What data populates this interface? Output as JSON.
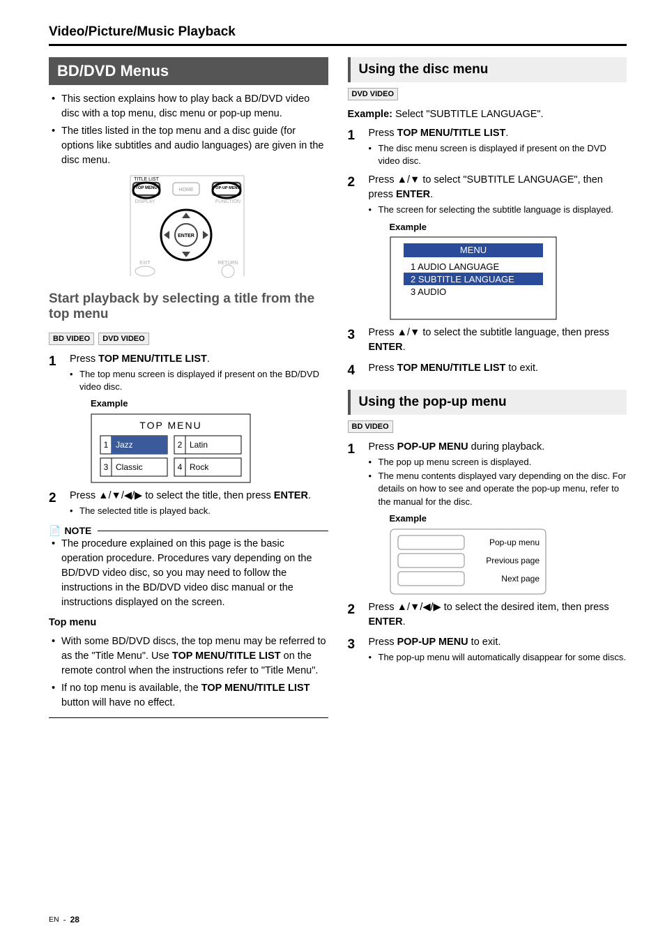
{
  "header": {
    "section_title": "Video/Picture/Music Playback"
  },
  "left": {
    "bar_title": "BD/DVD Menus",
    "intro_bullet1": "This section explains how to play back a BD/DVD video disc with a top menu, disc menu or pop-up menu.",
    "intro_bullet2": "The titles listed in the top menu and a disc guide (for options like subtitles and audio languages) are given in the disc menu.",
    "remote": {
      "title_list": "TITLE LIST",
      "top_menu": "TOP MENU",
      "home": "HOME",
      "popup_menu": "POP-UP MENU",
      "display": "DISPLAY",
      "function": "FUNCTION",
      "enter": "ENTER",
      "exit": "EXIT",
      "return": "RETURN"
    },
    "start_heading": "Start playback by selecting a title from the top menu",
    "tags": {
      "bd": "BD VIDEO",
      "dvd": "DVD VIDEO"
    },
    "step1_a": "Press ",
    "step1_b": "TOP MENU/TITLE LIST",
    "step1_sub": "The top menu screen is displayed if present on the BD/DVD video disc.",
    "example_label": "Example",
    "topmenu": {
      "title": "TOP MENU",
      "cell1": "Jazz",
      "cell2": "Latin",
      "cell3": "Classic",
      "cell4": "Rock"
    },
    "step2_a": "Press ",
    "step2_arrows": "▲/▼/◀/▶",
    "step2_b": " to select the title, then press ",
    "step2_c": "ENTER",
    "step2_sub": "The selected title is played back.",
    "note_label": "NOTE",
    "note_bullet": "The procedure explained on this page is the basic operation procedure. Procedures vary depending on the BD/DVD video disc, so you may need to follow the instructions in the BD/DVD video disc manual or the instructions displayed on the screen.",
    "topmenu_heading": "Top menu",
    "topmenu_b1a": "With some BD/DVD discs, the top menu may be referred to as the \"Title Menu\". Use ",
    "topmenu_b1b": "TOP MENU/TITLE LIST",
    "topmenu_b1c": " on the remote control when the instructions refer to \"Title Menu\".",
    "topmenu_b2a": "If no top menu is available, the ",
    "topmenu_b2b": "TOP MENU/TITLE LIST",
    "topmenu_b2c": " button will have no effect."
  },
  "right": {
    "disc_heading": "Using the disc menu",
    "tag_dvd": "DVD VIDEO",
    "example_prefix": "Example:",
    "example_text": " Select \"SUBTITLE LANGUAGE\".",
    "step1_a": "Press ",
    "step1_b": "TOP MENU/TITLE LIST",
    "step1_sub": "The disc menu screen is displayed if present on the DVD video disc.",
    "step2_a": "Press ",
    "step2_arrows": "▲/▼",
    "step2_b": " to select \"SUBTITLE LANGUAGE\", then press ",
    "step2_c": "ENTER",
    "step2_sub": "The screen for selecting the subtitle language is displayed.",
    "example_label": "Example",
    "menu": {
      "title": "MENU",
      "row1": "1  AUDIO LANGUAGE",
      "row2": "2  SUBTITLE LANGUAGE",
      "row3": "3  AUDIO"
    },
    "step3_a": "Press ",
    "step3_arrows": "▲/▼",
    "step3_b": " to select the subtitle language, then press ",
    "step3_c": "ENTER",
    "step4_a": "Press ",
    "step4_b": "TOP MENU/TITLE LIST",
    "step4_c": " to exit.",
    "popup_heading": "Using the pop-up menu",
    "tag_bd": "BD VIDEO",
    "p_step1_a": "Press ",
    "p_step1_b": "POP-UP MENU",
    "p_step1_c": " during playback.",
    "p_step1_sub1": "The pop up menu screen is displayed.",
    "p_step1_sub2": "The menu contents displayed vary depending on the disc. For details on how to see and operate the pop-up menu, refer to the manual for the disc.",
    "p_example_label": "Example",
    "popup_box": {
      "r1": "Pop-up menu",
      "r2": "Previous page",
      "r3": "Next page"
    },
    "p_step2_a": "Press ",
    "p_step2_arrows": "▲/▼/◀/▶",
    "p_step2_b": " to select the desired item, then press ",
    "p_step2_c": "ENTER",
    "p_step3_a": "Press ",
    "p_step3_b": "POP-UP MENU",
    "p_step3_c": " to exit.",
    "p_step3_sub": "The pop-up menu will automatically disappear for some discs."
  },
  "footer": {
    "en": "EN",
    "page": "28",
    "dash": " - "
  }
}
